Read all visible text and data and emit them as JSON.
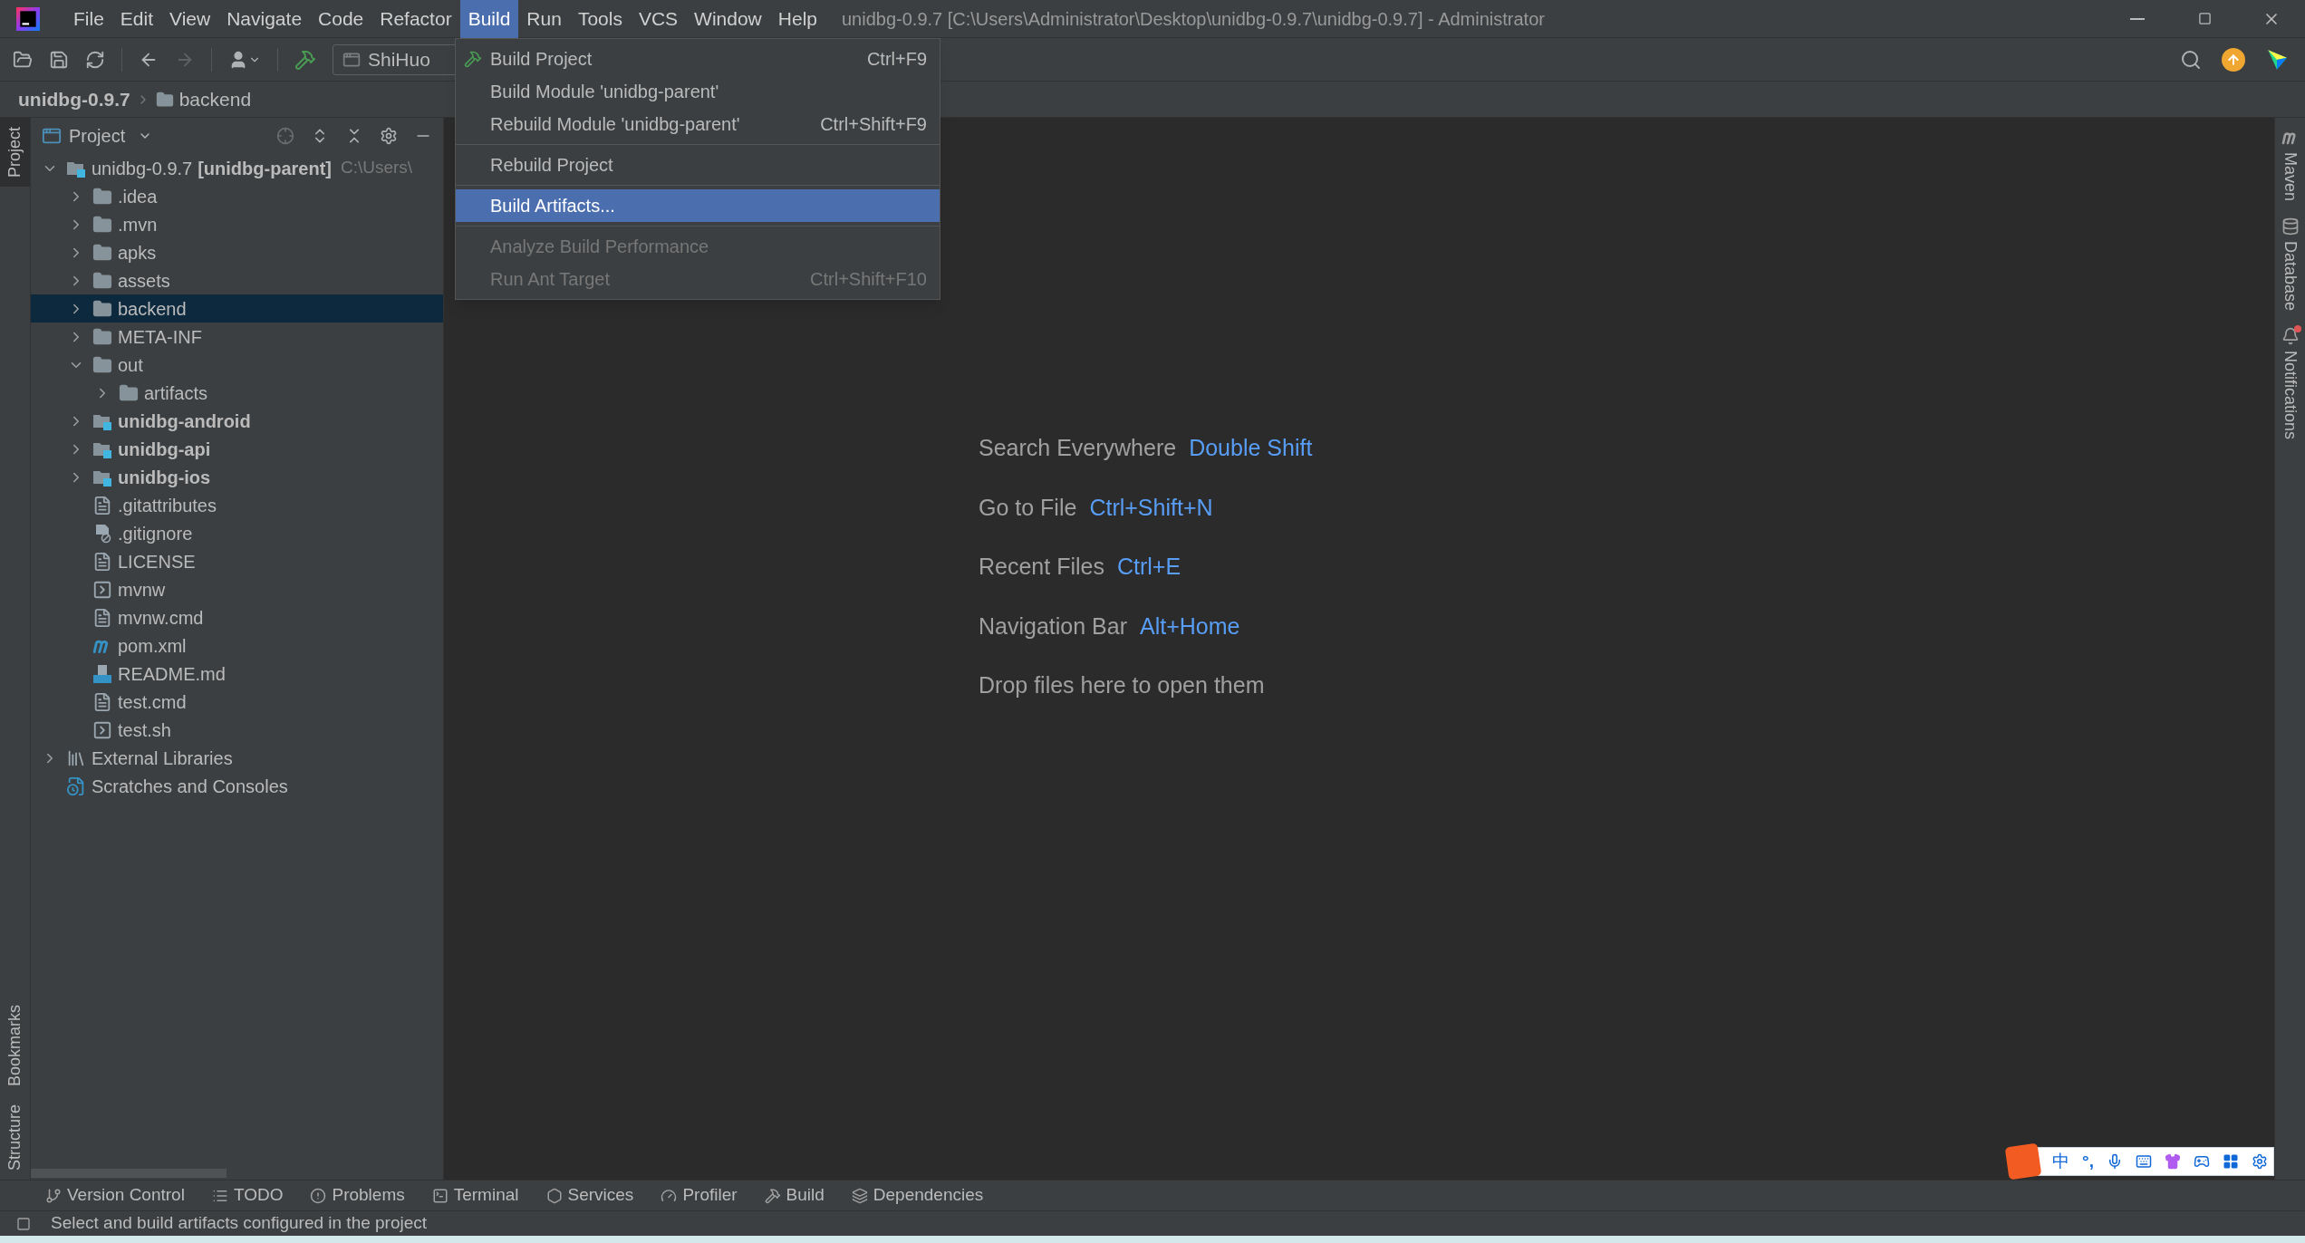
{
  "window": {
    "title": "unidbg-0.9.7 [C:\\Users\\Administrator\\Desktop\\unidbg-0.9.7\\unidbg-0.9.7] - Administrator"
  },
  "menu_bar": [
    {
      "label": "File",
      "selected": false
    },
    {
      "label": "Edit",
      "selected": false
    },
    {
      "label": "View",
      "selected": false
    },
    {
      "label": "Navigate",
      "selected": false
    },
    {
      "label": "Code",
      "selected": false
    },
    {
      "label": "Refactor",
      "selected": false
    },
    {
      "label": "Build",
      "selected": true
    },
    {
      "label": "Run",
      "selected": false
    },
    {
      "label": "Tools",
      "selected": false
    },
    {
      "label": "VCS",
      "selected": false
    },
    {
      "label": "Window",
      "selected": false
    },
    {
      "label": "Help",
      "selected": false
    }
  ],
  "toolbar": {
    "run_configuration": "ShiHuo"
  },
  "breadcrumb": [
    "unidbg-0.9.7",
    "backend"
  ],
  "left_strip": [
    {
      "label": "Project",
      "selected": true
    },
    {
      "label": "Bookmarks",
      "selected": false
    },
    {
      "label": "Structure",
      "selected": false
    }
  ],
  "right_strip": [
    {
      "label": "Maven",
      "kind": "maven"
    },
    {
      "label": "Database",
      "kind": "database"
    },
    {
      "label": "Notifications",
      "kind": "notifications"
    }
  ],
  "project_panel": {
    "title": "Project",
    "tree": [
      {
        "kind": "root",
        "label": "unidbg-0.9.7",
        "tag": "[unidbg-parent]",
        "path": "C:\\Users\\",
        "expanded": true,
        "selected": false,
        "children": [
          {
            "kind": "folder",
            "label": ".idea",
            "expanded": false,
            "selected": false
          },
          {
            "kind": "folder",
            "label": ".mvn",
            "expanded": false,
            "selected": false
          },
          {
            "kind": "folder",
            "label": "apks",
            "expanded": false,
            "selected": false
          },
          {
            "kind": "folder",
            "label": "assets",
            "expanded": false,
            "selected": false
          },
          {
            "kind": "folder",
            "label": "backend",
            "expanded": false,
            "selected": true
          },
          {
            "kind": "folder",
            "label": "META-INF",
            "expanded": false,
            "selected": false
          },
          {
            "kind": "folder",
            "label": "out",
            "expanded": true,
            "selected": false,
            "children": [
              {
                "kind": "folder",
                "label": "artifacts",
                "expanded": false,
                "selected": false
              }
            ]
          },
          {
            "kind": "module",
            "label": "unidbg-android",
            "expanded": false,
            "selected": false
          },
          {
            "kind": "module",
            "label": "unidbg-api",
            "expanded": false,
            "selected": false
          },
          {
            "kind": "module",
            "label": "unidbg-ios",
            "expanded": false,
            "selected": false
          },
          {
            "kind": "text",
            "label": ".gitattributes",
            "selected": false
          },
          {
            "kind": "ignore",
            "label": ".gitignore",
            "selected": false
          },
          {
            "kind": "text",
            "label": "LICENSE",
            "selected": false
          },
          {
            "kind": "script",
            "label": "mvnw",
            "selected": false
          },
          {
            "kind": "text",
            "label": "mvnw.cmd",
            "selected": false
          },
          {
            "kind": "maven",
            "label": "pom.xml",
            "selected": false
          },
          {
            "kind": "markdown",
            "label": "README.md",
            "selected": false
          },
          {
            "kind": "text",
            "label": "test.cmd",
            "selected": false
          },
          {
            "kind": "script",
            "label": "test.sh",
            "selected": false
          }
        ]
      },
      {
        "kind": "libraries",
        "label": "External Libraries",
        "expanded": false,
        "selected": false
      },
      {
        "kind": "scratches",
        "label": "Scratches and Consoles",
        "selected": false
      }
    ]
  },
  "build_menu": [
    {
      "kind": "build",
      "label": "Build Project",
      "shortcut": "Ctrl+F9",
      "selected": false,
      "disabled": false
    },
    {
      "kind": "item",
      "label": "Build Module 'unidbg-parent'",
      "selected": false,
      "disabled": false
    },
    {
      "kind": "item",
      "label": "Rebuild Module 'unidbg-parent'",
      "shortcut": "Ctrl+Shift+F9",
      "selected": false,
      "disabled": false
    },
    {
      "kind": "separator"
    },
    {
      "kind": "item",
      "label": "Rebuild Project",
      "selected": false,
      "disabled": false
    },
    {
      "kind": "separator"
    },
    {
      "kind": "item",
      "label": "Build Artifacts...",
      "selected": true,
      "disabled": false
    },
    {
      "kind": "separator"
    },
    {
      "kind": "item",
      "label": "Analyze Build Performance",
      "selected": false,
      "disabled": true
    },
    {
      "kind": "item",
      "label": "Run Ant Target",
      "shortcut": "Ctrl+Shift+F10",
      "selected": false,
      "disabled": true
    }
  ],
  "editor_hints": [
    {
      "action": "Search Everywhere",
      "shortcut": "Double Shift"
    },
    {
      "action": "Go to File",
      "shortcut": "Ctrl+Shift+N"
    },
    {
      "action": "Recent Files",
      "shortcut": "Ctrl+E"
    },
    {
      "action": "Navigation Bar",
      "shortcut": "Alt+Home"
    }
  ],
  "editor_note": "Drop files here to open them",
  "ime_toolbar": {
    "language": "中",
    "punctuation": "°,"
  },
  "bottom_tools": [
    {
      "label": "Version Control",
      "kind": "vcs"
    },
    {
      "label": "TODO",
      "kind": "todo"
    },
    {
      "label": "Problems",
      "kind": "problems"
    },
    {
      "label": "Terminal",
      "kind": "terminal"
    },
    {
      "label": "Services",
      "kind": "services"
    },
    {
      "label": "Profiler",
      "kind": "profiler"
    },
    {
      "label": "Build",
      "kind": "build"
    },
    {
      "label": "Dependencies",
      "kind": "dependencies"
    }
  ],
  "status_bar": {
    "message": "Select and build artifacts configured in the project"
  }
}
